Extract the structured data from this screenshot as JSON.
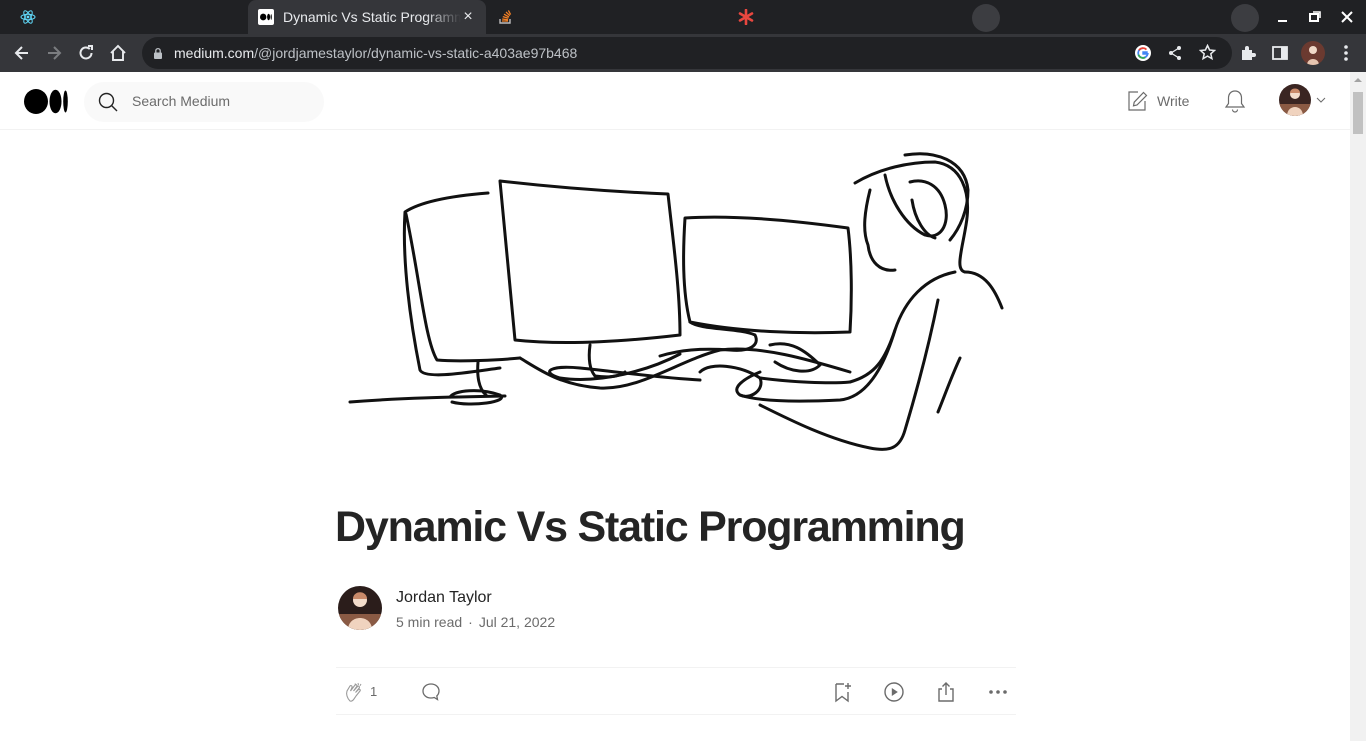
{
  "browser": {
    "tabs": [
      {
        "title": "",
        "icon": "react-icon"
      },
      {
        "title": "Dynamic Vs Static Programming",
        "icon": "medium-icon",
        "active": true
      },
      {
        "title": "",
        "icon": "stackoverflow-icon"
      },
      {
        "title": "",
        "icon": "asterisk-icon"
      }
    ],
    "url_host": "medium.com",
    "url_path": "/@jordjamestaylor/dynamic-vs-static-a403ae97b468"
  },
  "header": {
    "search_placeholder": "Search Medium",
    "write_label": "Write"
  },
  "article": {
    "title": "Dynamic Vs Static Programming",
    "author": "Jordan Taylor",
    "read_time": "5 min read",
    "separator": "·",
    "date": "Jul 21, 2022",
    "claps": "1"
  },
  "colors": {
    "chrome_dark": "#202124",
    "chrome_tab": "#35363a",
    "text_primary": "#242424",
    "text_secondary": "#6b6b6b"
  }
}
